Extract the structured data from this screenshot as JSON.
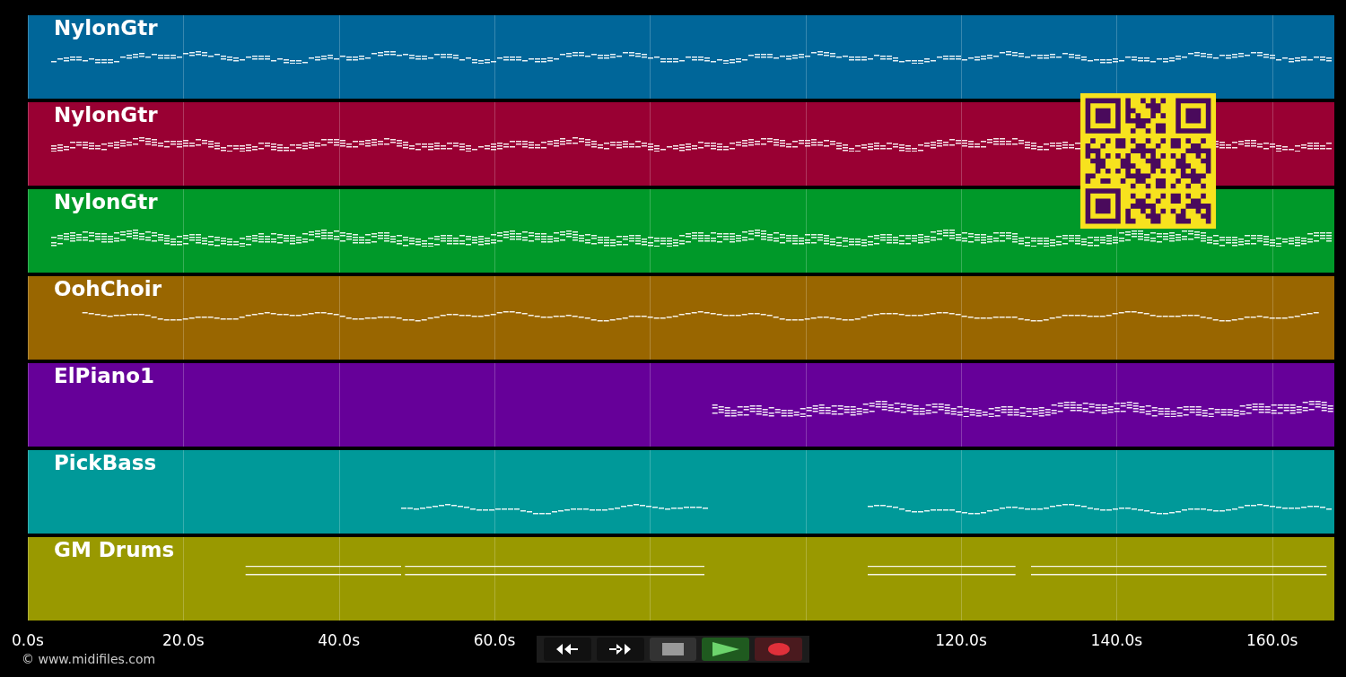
{
  "tracks": [
    {
      "name": "NylonGtr",
      "color": "#006699"
    },
    {
      "name": "NylonGtr",
      "color": "#990033"
    },
    {
      "name": "NylonGtr",
      "color": "#009929"
    },
    {
      "name": "OohChoir",
      "color": "#996600"
    },
    {
      "name": "ElPiano1",
      "color": "#660099"
    },
    {
      "name": "PickBass",
      "color": "#009999"
    },
    {
      "name": "GM Drums",
      "color": "#999900"
    }
  ],
  "timeline": {
    "ticks": [
      {
        "label": "0.0s"
      },
      {
        "label": "20.0s"
      },
      {
        "label": "40.0s"
      },
      {
        "label": "60.0s"
      },
      {
        "label": "120.0s"
      },
      {
        "label": "140.0s"
      },
      {
        "label": "160.0s"
      }
    ]
  },
  "transport": [
    {
      "kind": "rewind"
    },
    {
      "kind": "forward"
    },
    {
      "kind": "stop"
    },
    {
      "kind": "play"
    },
    {
      "kind": "record"
    }
  ],
  "copyright": "© www.midifiles.com"
}
